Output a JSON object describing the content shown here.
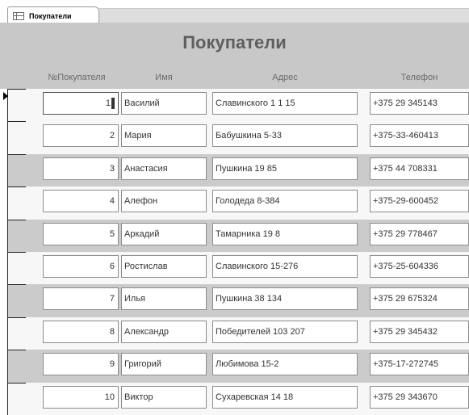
{
  "tab": {
    "label": "Покупатели",
    "icon": "table-icon"
  },
  "form": {
    "title": "Покупатели"
  },
  "columns": [
    "№Покупателя",
    "Имя",
    "Адрес",
    "Телефон"
  ],
  "records": [
    {
      "num": "1",
      "name": "Василий",
      "address": "Славинского 1 1 15",
      "phone": "+375 29 345143"
    },
    {
      "num": "2",
      "name": "Мария",
      "address": "Бабушкина 5-33",
      "phone": "+375-33-460413"
    },
    {
      "num": "3",
      "name": "Анастасия",
      "address": "Пушкина 19 85",
      "phone": "+375 44 708331"
    },
    {
      "num": "4",
      "name": "Алефон",
      "address": "Голодеда 8-384",
      "phone": "+375-29-600452"
    },
    {
      "num": "5",
      "name": "Аркадий",
      "address": "Тамарника 19 8",
      "phone": "+375 29 778467"
    },
    {
      "num": "6",
      "name": "Ростислав",
      "address": "Славинского 15-276",
      "phone": "+375-25-604336"
    },
    {
      "num": "7",
      "name": "Илья",
      "address": "Пушкина 38 134",
      "phone": "+375 29 675324"
    },
    {
      "num": "8",
      "name": "Александр",
      "address": "Победителей 103 207",
      "phone": "+375 29 345432"
    },
    {
      "num": "9",
      "name": "Григорий",
      "address": "Любимова 15-2",
      "phone": "+375-17-272745"
    },
    {
      "num": "10",
      "name": "Виктор",
      "address": "Сухаревская 14 18",
      "phone": "+375 29 343670"
    }
  ],
  "colors": {
    "header_bg": "#c8c8c8",
    "shaded_row": "#cbcbcb",
    "light_row": "#f7f7f7",
    "title": "#5e5e5e"
  }
}
